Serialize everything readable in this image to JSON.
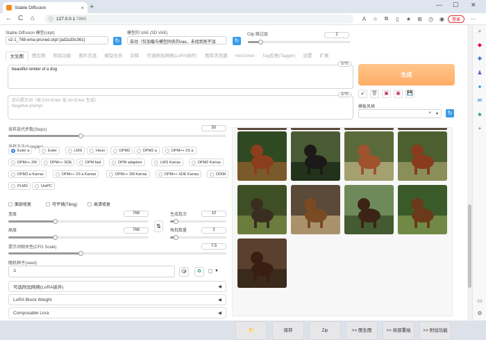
{
  "browser": {
    "tab_title": "Stable Diffusion",
    "tab_close": "×",
    "new_tab": "+",
    "url_host": "127.0.0.1",
    "url_port": ":7860",
    "login_label": "登录",
    "win_min": "—",
    "win_max": "☐",
    "win_close": "✕",
    "back": "←",
    "refresh": "C",
    "home": "⌂"
  },
  "settings": {
    "model_label": "Stable Diffusion 模型(ckpt)",
    "model_value": "v2-1_768-ema-pruned.ckpt [ad2a33c361]",
    "vae_label": "模型的 VAE (SD VAE)",
    "vae_value": "自动（仅加载与模型同名的vae，未找到则不加",
    "clip_label": "Clip 跳过层",
    "clip_value": "2"
  },
  "tabs": [
    "文生图",
    "图生图",
    "附加功能",
    "图片信息",
    "模型合并",
    "训练",
    "可选附加网络(LoRA插件)",
    "图库浏览器",
    "mov2mov",
    "Tag反推(Tagger)",
    "设置",
    "扩展"
  ],
  "prompt": {
    "text": "beautiful render of a dog",
    "counter": "5/75",
    "negative_placeholder_1": "反向提示词（按 Ctrl+Enter 或 Alt+Enter 生成）",
    "negative_placeholder_2": "Negative prompt",
    "negative_counter": "0/75"
  },
  "generate_label": "生成",
  "tools": [
    "↙",
    "🗑",
    "▣",
    "▣",
    "💾"
  ],
  "styles_label": "模板风格",
  "styles_clear": "×",
  "styles_arrow": "▾",
  "steps": {
    "label": "采样迭代步数(Steps)",
    "value": "50",
    "fraction": 0.33
  },
  "sampler_label": "采样方法(Sampler)",
  "samplers": [
    [
      "Euler a",
      "Euler",
      "LMS",
      "Heun",
      "DPM2",
      "DPM2 a",
      "DPM++ 2S a"
    ],
    [
      "DPM++ 2M",
      "DPM++ SDE",
      "DPM fast",
      "DPM adaptive",
      "LMS Karras",
      "DPM2 Karras"
    ],
    [
      "DPM2 a Karras",
      "DPM++ 2S a Karras",
      "DPM++ 2M Karras",
      "DPM++ SDE Karras",
      "DDIM"
    ],
    [
      "PLMS",
      "UniPC"
    ]
  ],
  "selected_sampler": "Euler a",
  "checkboxes": [
    "面部修复",
    "可平铺(Tiling)",
    "高清修复"
  ],
  "width": {
    "label": "宽度",
    "value": "768",
    "fraction": 0.33
  },
  "height": {
    "label": "高度",
    "value": "768",
    "fraction": 0.33
  },
  "batch_count": {
    "label": "生成批次",
    "value": "10",
    "fraction": 0.1
  },
  "batch_size": {
    "label": "每批数量",
    "value": "2",
    "fraction": 0.1
  },
  "cfg": {
    "label": "提示词相关性(CFG Scale)",
    "value": "7.5",
    "fraction": 0.33
  },
  "seed": {
    "label": "随机种子(seed)",
    "value": "-1"
  },
  "accordions": [
    "可选附加网络(LoRA插件)",
    "LoRA Block Weight",
    "Composable Lora"
  ],
  "accordion_arrow": "◀",
  "swap_icon": "⇅",
  "gallery_buttons": [
    "📁",
    "保存",
    "Zip",
    ">> 图生图",
    ">> 局部重绘",
    ">> 附加功能"
  ],
  "colors": {
    "accent": "#ff9e4a",
    "primary_blue": "#3a9be8"
  }
}
